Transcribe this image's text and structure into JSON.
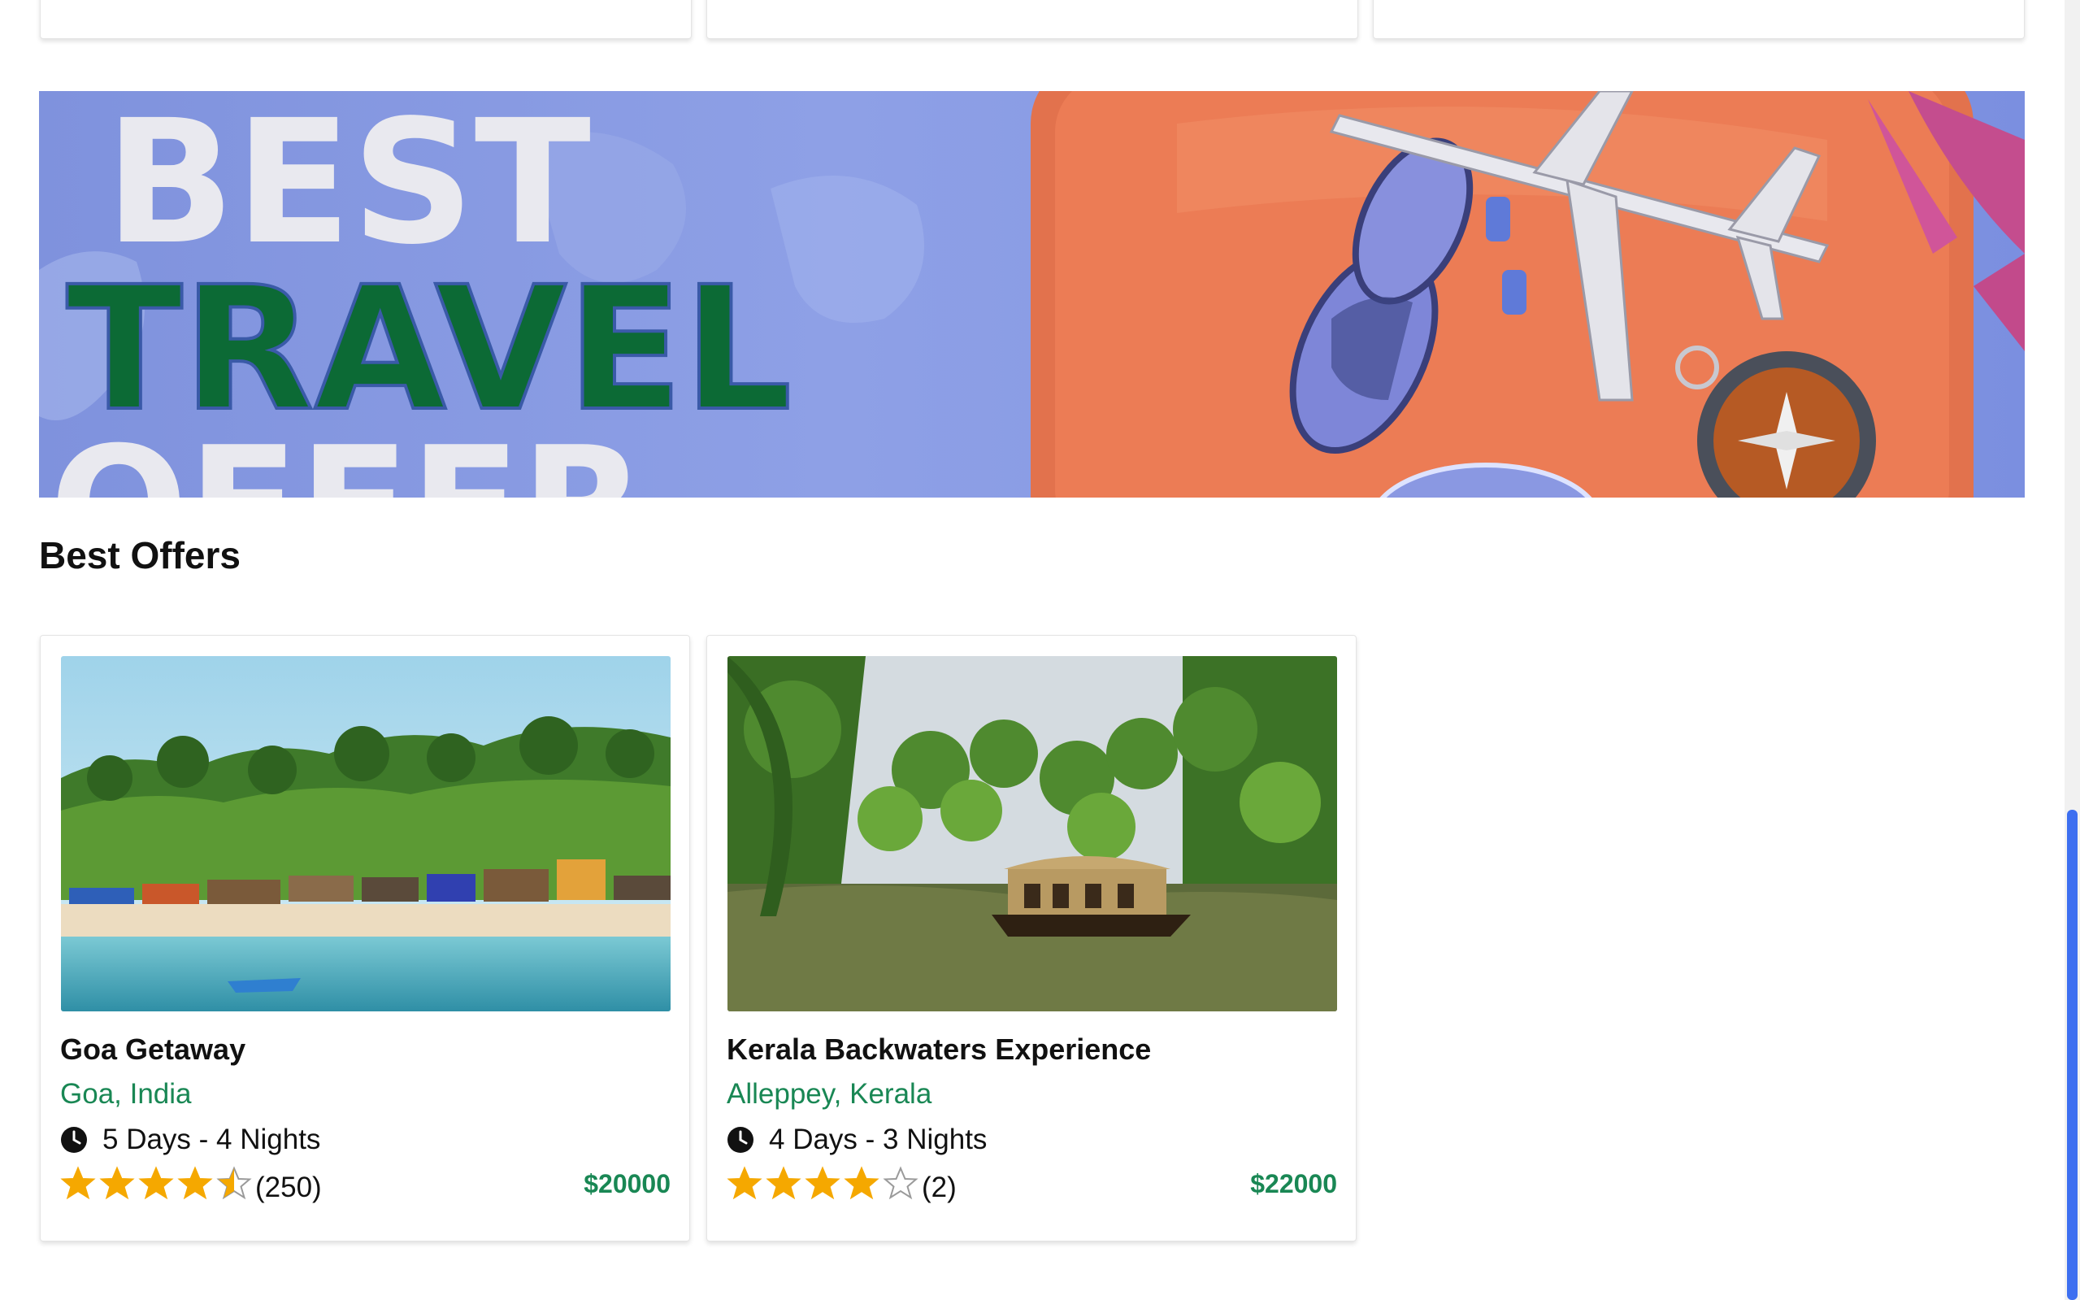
{
  "banner": {
    "line1": "BEST",
    "line2": "TRAVEL",
    "line3": "OFFER"
  },
  "section": {
    "title": "Best Offers"
  },
  "cards": [
    {
      "title": "Goa Getaway",
      "location": "Goa, India",
      "duration": "5 Days - 4 Nights",
      "rating": 4.5,
      "reviews": "(250)",
      "price": "$20000"
    },
    {
      "title": "Kerala Backwaters Experience",
      "location": "Alleppey, Kerala",
      "duration": "4 Days - 3 Nights",
      "rating": 4,
      "reviews": "(2)",
      "price": "$22000"
    }
  ],
  "colors": {
    "accent_green": "#198754",
    "star": "#f5a800",
    "scroll_thumb": "#3d6ff0"
  }
}
